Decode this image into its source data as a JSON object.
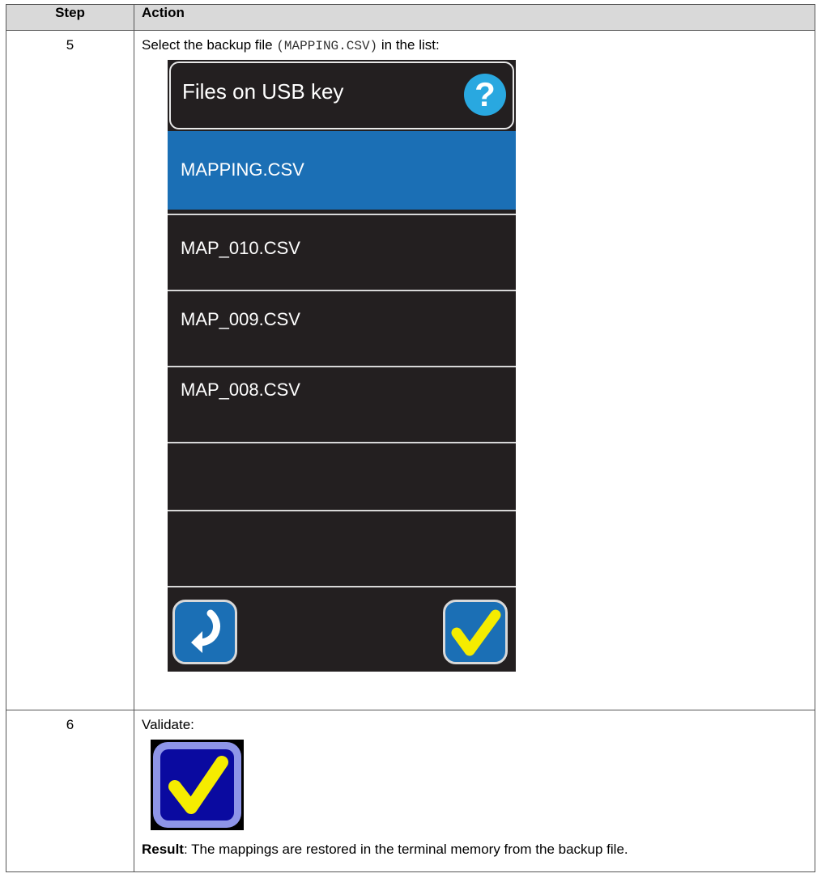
{
  "table": {
    "header_step": "Step",
    "header_action": "Action"
  },
  "step5": {
    "number": "5",
    "text_before": "Select the backup file ",
    "filename": "(MAPPING.CSV)",
    "text_after": " in the list:",
    "screen": {
      "title": "Files on USB key",
      "help_icon": "question-icon",
      "files": [
        "MAPPING.CSV",
        "MAP_010.CSV",
        "MAP_009.CSV",
        "MAP_008.CSV"
      ],
      "selected_color": "#1b6fb5",
      "back_icon": "return-arrow-icon",
      "confirm_icon": "checkmark-icon"
    }
  },
  "step6": {
    "number": "6",
    "text": "Validate:",
    "icon": "checkmark-icon",
    "result_label": "Result",
    "result_text": ": The mappings are restored in the terminal memory from the backup file."
  }
}
